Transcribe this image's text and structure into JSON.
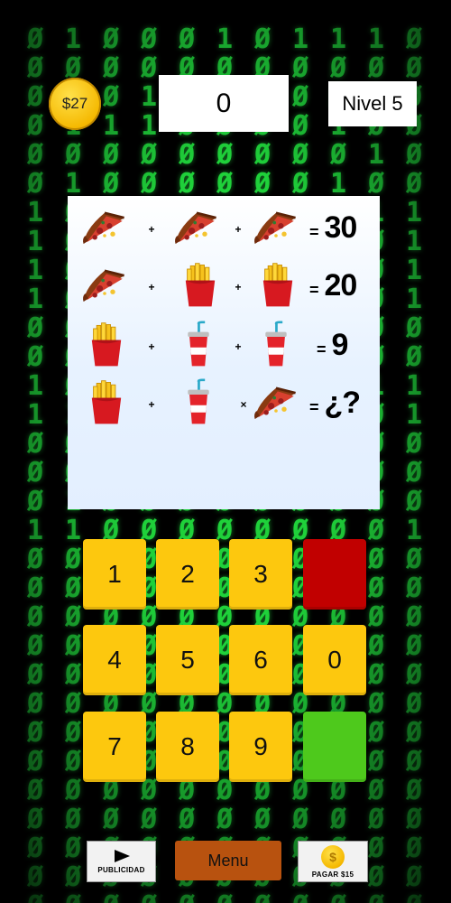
{
  "hud": {
    "coins": "$27",
    "score": "0",
    "level": "Nivel 5"
  },
  "matrix_rows": [
    "0100010111",
    "0000000000",
    "0101000000",
    "0111000010",
    "0000000001",
    "0100000010",
    "1000000001",
    "1000000000",
    "1000000000",
    "1000000000",
    "0000000000",
    "0000000000",
    "1000000001",
    "1100000100",
    "0000000000",
    "0000000000",
    "0100000000",
    "1100000000",
    "0000000000",
    "0000000000",
    "0000000000",
    "0000000000",
    "0000000000",
    "0000000000",
    "0000000000",
    "0000000000",
    "0000000000",
    "0000000000",
    "0000000000",
    "0000000000",
    "0000000000"
  ],
  "puzzle": {
    "rows": [
      {
        "items": [
          "pizza-icon",
          "pizza-icon",
          "pizza-icon"
        ],
        "ops": [
          "+",
          "+"
        ],
        "eq": "=",
        "result": "30"
      },
      {
        "items": [
          "pizza-icon",
          "fries-icon",
          "fries-icon"
        ],
        "ops": [
          "+",
          "+"
        ],
        "eq": "=",
        "result": "20"
      },
      {
        "items": [
          "fries-icon",
          "soda-icon",
          "soda-icon"
        ],
        "ops": [
          "+",
          "+"
        ],
        "eq": "=",
        "result": "9"
      },
      {
        "items": [
          "fries-icon",
          "soda-icon",
          "pizza-icon"
        ],
        "ops": [
          "+",
          "×"
        ],
        "eq": "=",
        "result": "¿?"
      }
    ]
  },
  "keypad": {
    "keys": [
      "1",
      "2",
      "3",
      "",
      "4",
      "5",
      "6",
      "0",
      "7",
      "8",
      "9",
      ""
    ],
    "key_names": [
      "key-1",
      "key-2",
      "key-3",
      "delete-button",
      "key-4",
      "key-5",
      "key-6",
      "key-0",
      "key-7",
      "key-8",
      "key-9",
      "submit-button"
    ]
  },
  "bottom": {
    "ad_label": "PUBLICIDAD",
    "menu_label": "Menu",
    "pay_label": "PAGAR $15",
    "pay_coin_glyph": "$"
  },
  "colors": {
    "matrix_green": "#1fd13a",
    "key_yellow": "#fdc80e",
    "delete_red": "#c10000",
    "submit_green": "#4ec91c",
    "menu_brown": "#b8520f",
    "coin_gold": "#f5b800"
  }
}
